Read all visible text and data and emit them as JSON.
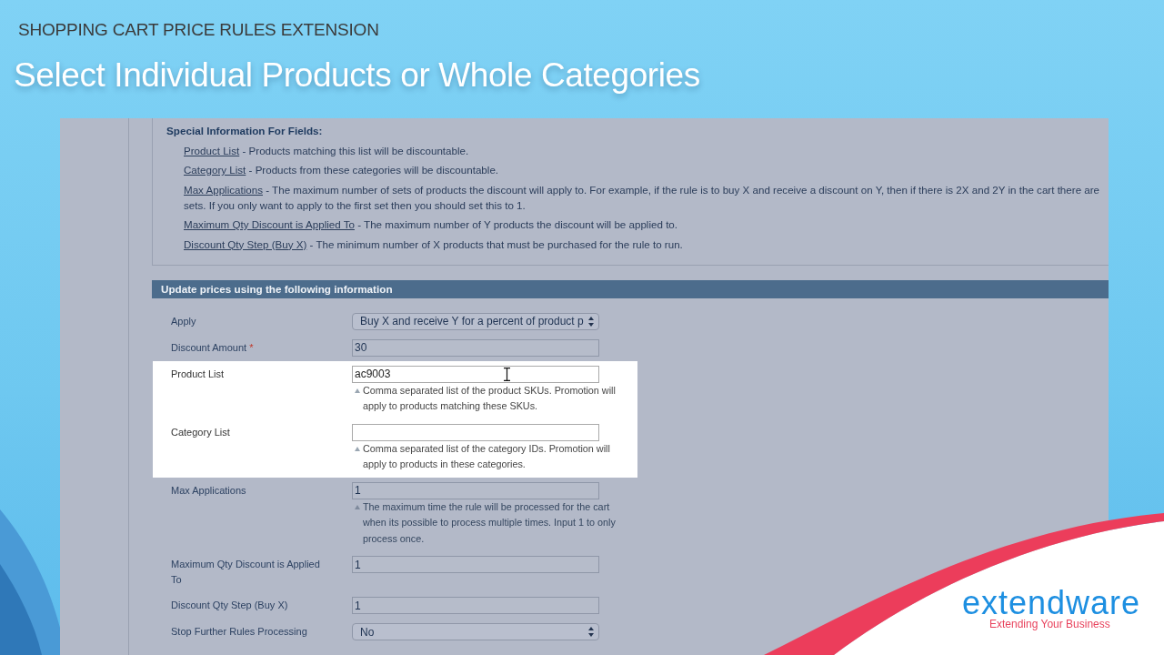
{
  "slide": {
    "kicker": "SHOPPING CART PRICE RULES EXTENSION",
    "title": "Select Individual Products or Whole Categories"
  },
  "special_info": {
    "heading": "Special Information For Fields:",
    "items": [
      {
        "term": "Product List",
        "description": "- Products matching this list will be discountable."
      },
      {
        "term": "Category List",
        "description": "- Products from these categories will be discountable."
      },
      {
        "term": "Max Applications",
        "description": "- The maximum number of sets of products the discount will apply to. For example, if the rule is to buy X and receive a discount on Y, then if there is 2X and 2Y in the cart there are sets. If you only want to apply to the first set then you should set this to 1."
      },
      {
        "term": "Maximum Qty Discount is Applied To",
        "description": "- The maximum number of Y products the discount will be applied to."
      },
      {
        "term": "Discount Qty Step (Buy X)",
        "description": "- The minimum number of X products that must be purchased for the rule to run."
      }
    ]
  },
  "section": {
    "title": "Update prices using the following information",
    "fields": [
      {
        "kind": "select",
        "label": "Apply",
        "value": "Buy X and receive Y for a percent of product p",
        "highlighted": false,
        "hovered": false
      },
      {
        "kind": "text",
        "label": "Discount Amount",
        "required_mark": "*",
        "value": "30",
        "highlighted": false,
        "hovered": false
      },
      {
        "kind": "text",
        "label": "Product List",
        "value": "ac9003",
        "hint": "Comma separated list of the product SKUs. Promotion will apply to products matching these SKUs.",
        "highlighted": true,
        "hovered": true
      },
      {
        "kind": "text",
        "label": "Category List",
        "hint": "Comma separated list of the category IDs. Promotion will apply to products in these categories.",
        "highlighted": true,
        "hovered": false
      },
      {
        "kind": "text",
        "label": "Max Applications",
        "value": "1",
        "hint": "The maximum time the rule will be processed for the cart when its possible to process multiple times. Input 1 to only process once.",
        "highlighted": false,
        "hovered": false
      },
      {
        "kind": "text",
        "label": "Maximum Qty Discount is Applied To",
        "value": "1",
        "highlighted": false,
        "hovered": false
      },
      {
        "kind": "text",
        "label": "Discount Qty Step (Buy X)",
        "value": "1",
        "highlighted": false,
        "hovered": false
      },
      {
        "kind": "select",
        "label": "Stop Further Rules Processing",
        "value": "No",
        "highlighted": false,
        "hovered": false
      }
    ]
  },
  "logo": {
    "wordmark": "extendware",
    "tagline": "Extending Your Business"
  }
}
